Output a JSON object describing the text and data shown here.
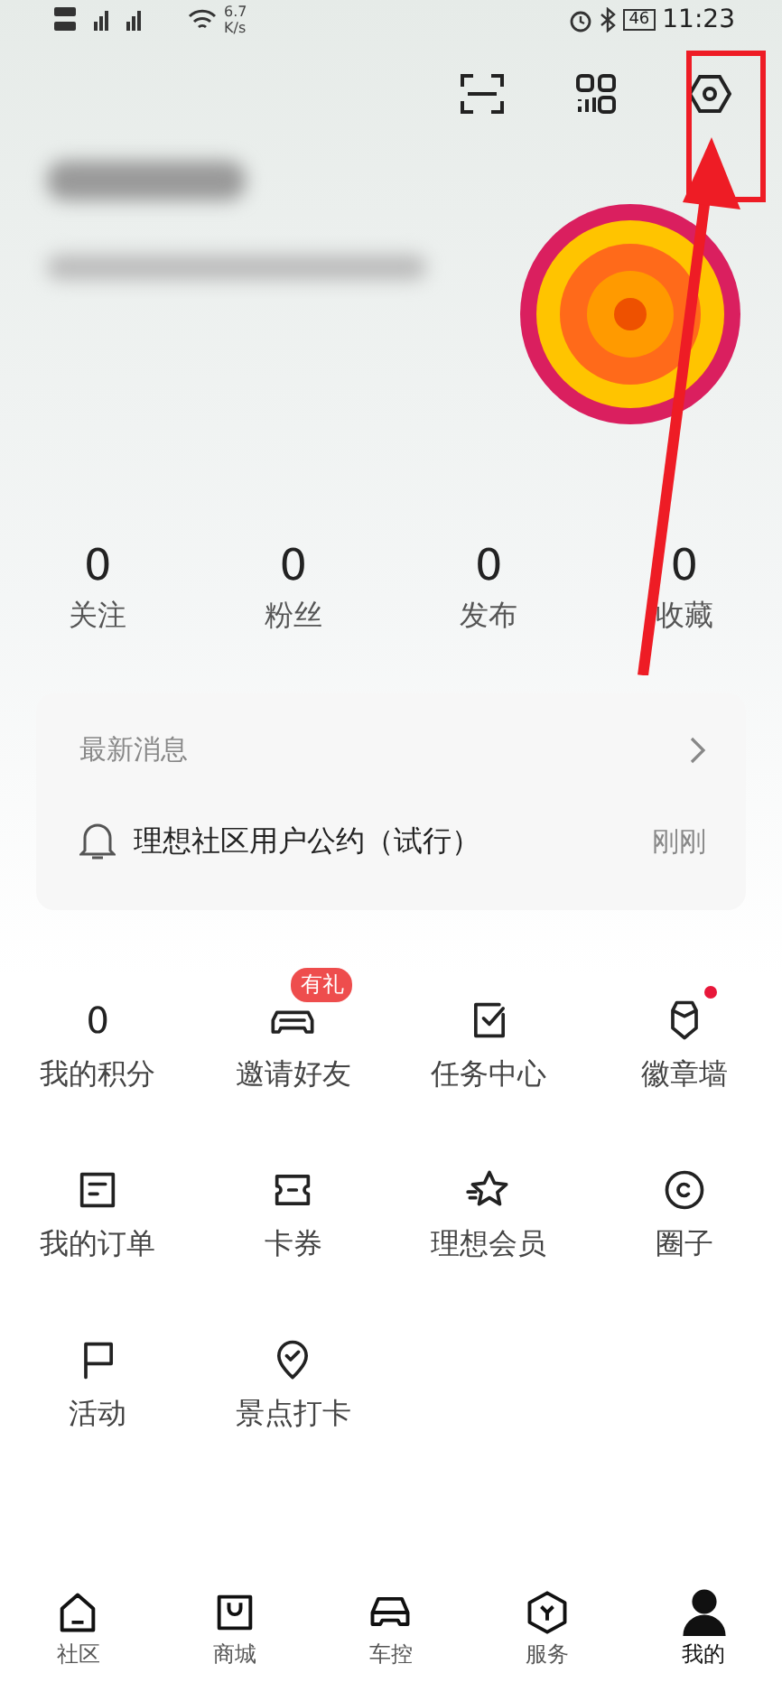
{
  "status_bar": {
    "speed": "6.7",
    "speed_unit": "K/s",
    "battery": "46",
    "time": "11:23"
  },
  "stats": [
    {
      "value": "0",
      "label": "关注"
    },
    {
      "value": "0",
      "label": "粉丝"
    },
    {
      "value": "0",
      "label": "发布"
    },
    {
      "value": "0",
      "label": "收藏"
    }
  ],
  "news": {
    "title": "最新消息",
    "message": "理想社区用户公约（试行）",
    "time": "刚刚"
  },
  "grid": [
    {
      "kind": "count",
      "value": "0",
      "label": "我的积分"
    },
    {
      "kind": "icon",
      "label": "邀请好友",
      "badge": "有礼"
    },
    {
      "kind": "icon",
      "label": "任务中心"
    },
    {
      "kind": "icon",
      "label": "徽章墙",
      "dot": true
    },
    {
      "kind": "icon",
      "label": "我的订单"
    },
    {
      "kind": "icon",
      "label": "卡券"
    },
    {
      "kind": "icon",
      "label": "理想会员"
    },
    {
      "kind": "icon",
      "label": "圈子"
    },
    {
      "kind": "icon",
      "label": "活动"
    },
    {
      "kind": "icon",
      "label": "景点打卡"
    }
  ],
  "tabs": [
    {
      "label": "社区",
      "selected": false
    },
    {
      "label": "商城",
      "selected": false
    },
    {
      "label": "车控",
      "selected": false
    },
    {
      "label": "服务",
      "selected": false
    },
    {
      "label": "我的",
      "selected": true
    }
  ]
}
